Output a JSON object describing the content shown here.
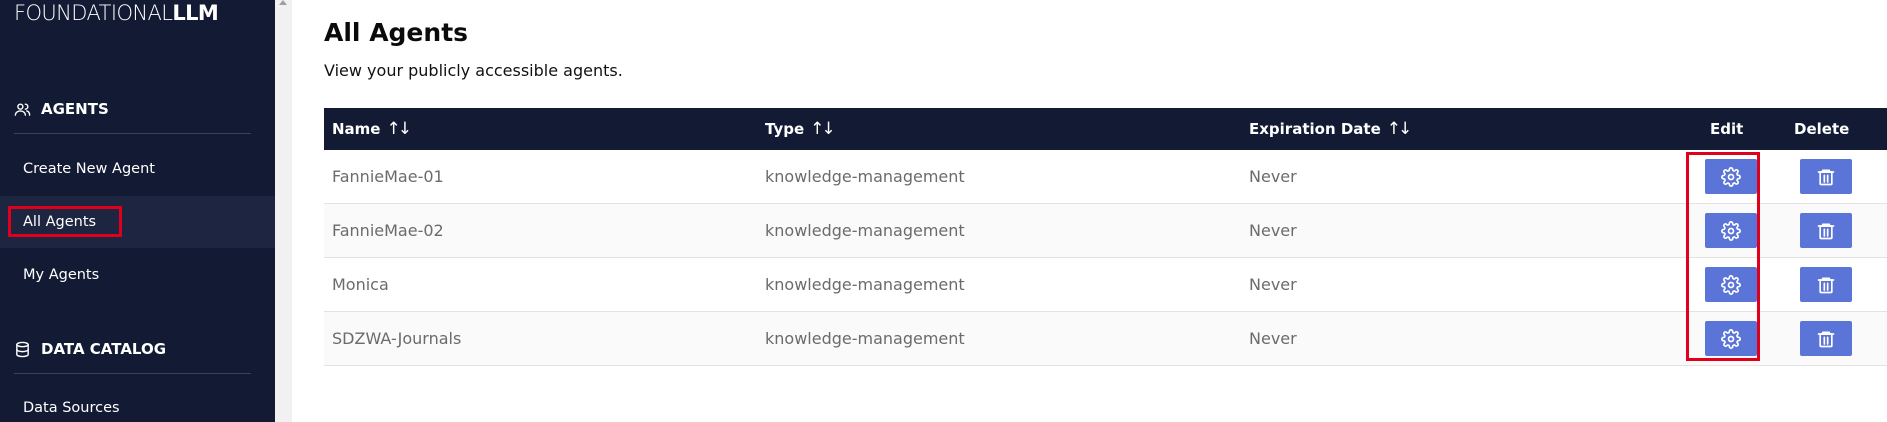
{
  "brand": {
    "light": "FOUNDATIONAL",
    "bold": "LLM"
  },
  "sidebar": {
    "sections": [
      {
        "title": "AGENTS",
        "icon": "users-icon",
        "items": [
          {
            "label": "Create New Agent"
          },
          {
            "label": "All Agents",
            "active": true
          },
          {
            "label": "My Agents"
          }
        ]
      },
      {
        "title": "DATA CATALOG",
        "icon": "database-icon",
        "items": [
          {
            "label": "Data Sources"
          }
        ]
      }
    ]
  },
  "page": {
    "title": "All Agents",
    "subtitle": "View your publicly accessible agents."
  },
  "table": {
    "headers": {
      "name": "Name",
      "type": "Type",
      "expiration": "Expiration Date",
      "edit": "Edit",
      "delete": "Delete"
    },
    "sort_icon": "↑↓",
    "rows": [
      {
        "name": "FannieMae-01",
        "type": "knowledge-management",
        "expiration": "Never"
      },
      {
        "name": "FannieMae-02",
        "type": "knowledge-management",
        "expiration": "Never"
      },
      {
        "name": "Monica",
        "type": "knowledge-management",
        "expiration": "Never"
      },
      {
        "name": "SDZWA-Journals",
        "type": "knowledge-management",
        "expiration": "Never"
      }
    ]
  },
  "colors": {
    "sidebar_bg": "#131a33",
    "header_bg": "#131a33",
    "button": "#5b74d8",
    "highlight": "#e0001b"
  }
}
